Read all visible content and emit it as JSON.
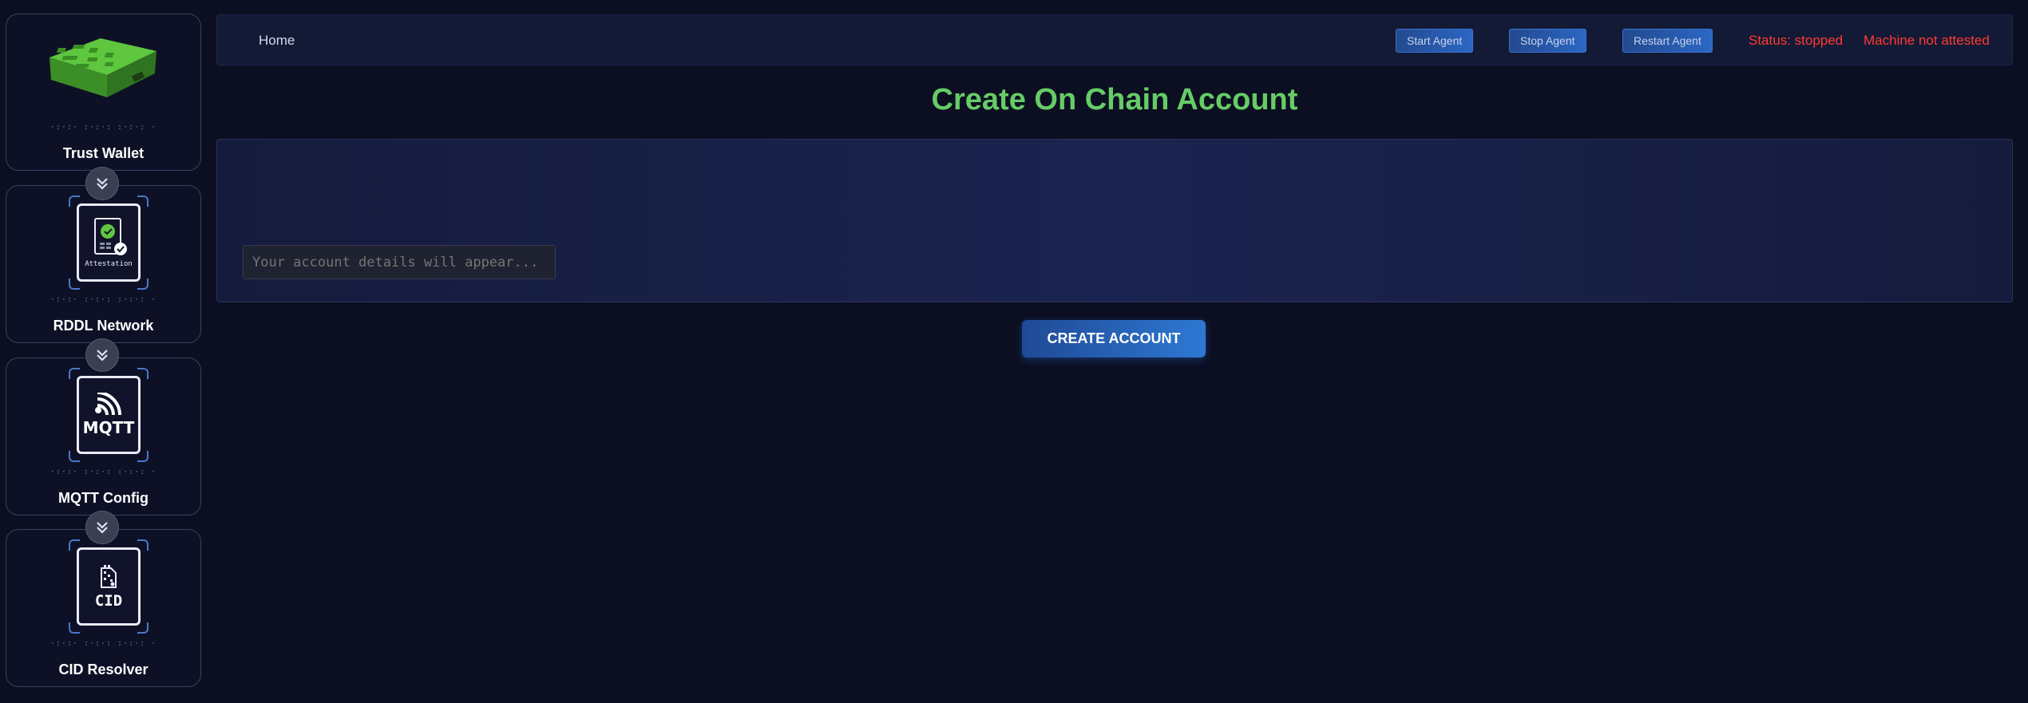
{
  "sidebar": {
    "items": [
      {
        "label": "Trust Wallet",
        "dots": "·:·:·  :·:·:  :·:·:  ·"
      },
      {
        "label": "RDDL Network",
        "tile_text": "Attestation",
        "dots": "·:·:·  :·:·:  :·:·:  ·"
      },
      {
        "label": "MQTT Config",
        "tile_text": "MQTT",
        "dots": "·:·:·  :·:·:  :·:·:  ·"
      },
      {
        "label": "CID Resolver",
        "tile_text": "CID",
        "dots": "·:·:·  :·:·:  :·:·:  ·"
      }
    ],
    "connector_icon": "double-chevron-down-icon"
  },
  "header": {
    "home": "Home",
    "start_agent": "Start Agent",
    "stop_agent": "Stop Agent",
    "restart_agent": "Restart Agent",
    "status": "Status: stopped",
    "attestation": "Machine not attested"
  },
  "main": {
    "title": "Create On Chain Account",
    "details_placeholder": "Your account details will appear...",
    "create_button": "CREATE ACCOUNT"
  },
  "colors": {
    "background": "#0c0f22",
    "title": "#66cc66",
    "status_error": "#ff3b30",
    "accent": "#2b67c4"
  }
}
